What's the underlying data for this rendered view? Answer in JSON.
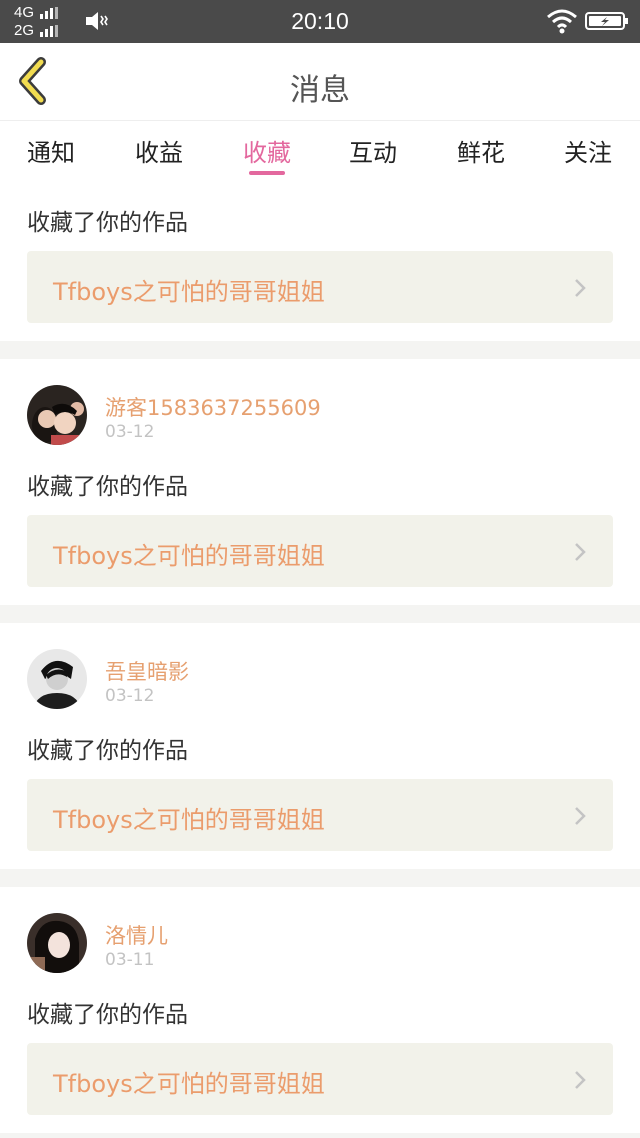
{
  "status_bar": {
    "network_top": "4G",
    "network_bottom": "2G",
    "time": "20:10"
  },
  "header": {
    "back_icon": "chevron-left-icon",
    "title": "消息"
  },
  "tabs": [
    {
      "label": "通知",
      "active": false
    },
    {
      "label": "收益",
      "active": false
    },
    {
      "label": "收藏",
      "active": true
    },
    {
      "label": "互动",
      "active": false
    },
    {
      "label": "鲜花",
      "active": false
    },
    {
      "label": "关注",
      "active": false
    }
  ],
  "feed": [
    {
      "user": "",
      "date": "",
      "action": "收藏了你的作品",
      "work_title": "Tfboys之可怕的哥哥姐姐"
    },
    {
      "user": "游客1583637255609",
      "date": "03-12",
      "action": "收藏了你的作品",
      "work_title": "Tfboys之可怕的哥哥姐姐"
    },
    {
      "user": "吾皇暗影",
      "date": "03-12",
      "action": "收藏了你的作品",
      "work_title": "Tfboys之可怕的哥哥姐姐"
    },
    {
      "user": "洛情儿",
      "date": "03-11",
      "action": "收藏了你的作品",
      "work_title": "Tfboys之可怕的哥哥姐姐"
    }
  ],
  "colors": {
    "accent_pink": "#e3689e",
    "name_orange": "#e6a070",
    "work_title_orange": "#eb9c6c",
    "back_icon_yellow": "#f2dc50"
  }
}
